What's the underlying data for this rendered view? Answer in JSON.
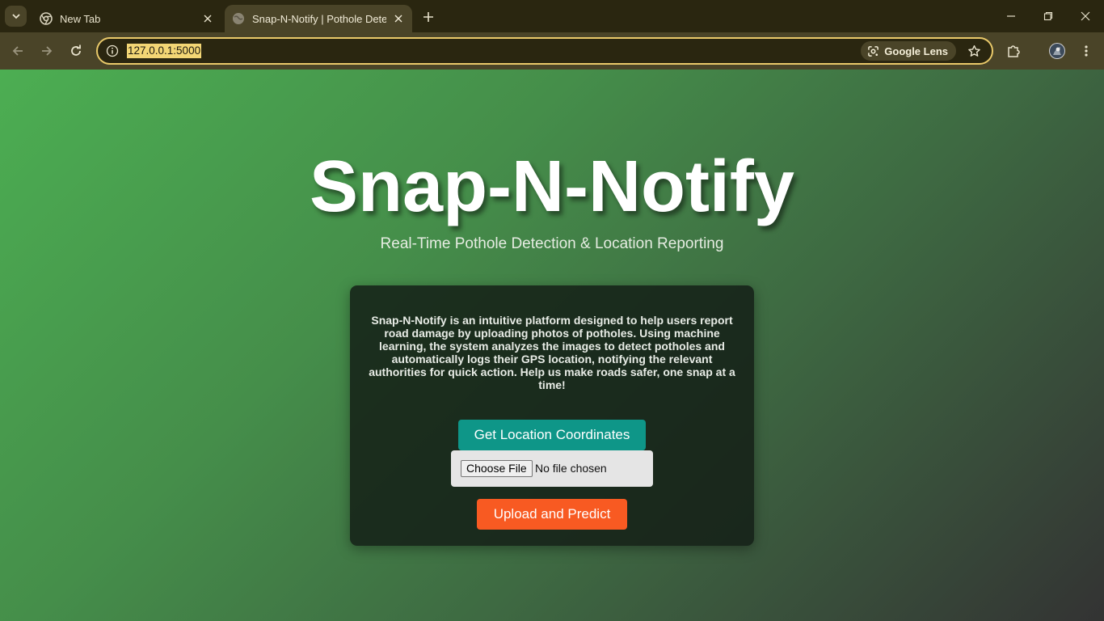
{
  "browser": {
    "tabs": [
      {
        "title": "New Tab",
        "active": false
      },
      {
        "title": "Snap-N-Notify | Pothole Detection",
        "active": true
      }
    ],
    "url": "127.0.0.1:5000",
    "lens_label": "Google Lens",
    "icons": {
      "tab_search": "chevron-down-icon",
      "new_tab_favicon": "chrome-icon",
      "page_favicon": "globe-icon",
      "new_tab": "plus-icon",
      "back": "arrow-left-icon",
      "forward": "arrow-right-icon",
      "reload": "reload-icon",
      "site_info": "info-icon",
      "bookmark": "star-icon",
      "extensions": "puzzle-icon",
      "profile": "avatar-icon",
      "menu": "more-vert-icon"
    },
    "colors": {
      "frame": "#2a2610",
      "toolbar": "#4a4428",
      "accent": "#e9c96a"
    }
  },
  "page": {
    "title": "Snap-N-Notify",
    "subtitle": "Real-Time Pothole Detection & Location Reporting",
    "description": "Snap-N-Notify is an intuitive platform designed to help users report road damage by uploading photos of potholes. Using machine learning, the system analyzes the images to detect potholes and automatically logs their GPS location, notifying the relevant authorities for quick action. Help us make roads safer, one snap at a time!",
    "get_location_label": "Get Location Coordinates",
    "choose_file_label": "Choose File",
    "no_file_label": "No file chosen",
    "upload_label": "Upload and Predict",
    "colors": {
      "location_button": "#0e9688",
      "upload_button": "#f85a22",
      "card": "#1c2a1f"
    }
  }
}
